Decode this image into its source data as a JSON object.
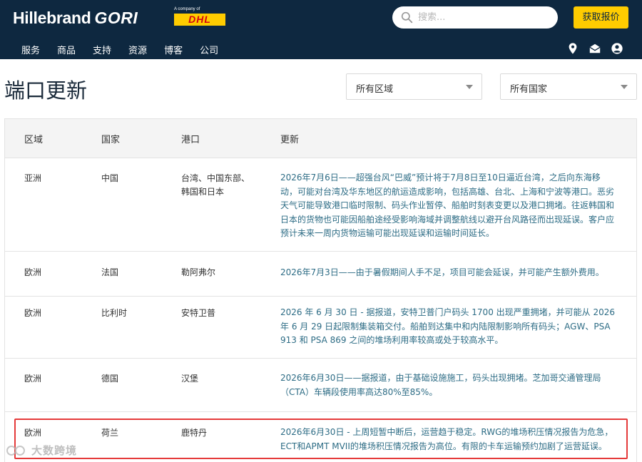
{
  "brand": {
    "name": "Hillebrand",
    "name2": "GORI",
    "company_of": "A company of",
    "parent_logo": "DHL"
  },
  "search": {
    "placeholder": "搜索..."
  },
  "header": {
    "quote_button": "获取报价"
  },
  "nav": {
    "items": [
      "服务",
      "商品",
      "支持",
      "资源",
      "博客",
      "公司"
    ]
  },
  "header_icons": [
    "location-pin-icon",
    "mail-icon",
    "user-icon"
  ],
  "page": {
    "title": "端口更新"
  },
  "filters": {
    "region": "所有区域",
    "country": "所有国家"
  },
  "table": {
    "columns": [
      "区域",
      "国家",
      "港口",
      "更新"
    ],
    "rows": [
      {
        "region": "亚洲",
        "country": "中国",
        "port": "台湾、中国东部、韩国和日本",
        "update": "2026年7月6日——超强台风“巴威”预计将于7月8日至10日逼近台湾，之后向东海移动，可能对台湾及华东地区的航运造成影响，包括高雄、台北、上海和宁波等港口。恶劣天气可能导致港口临时限制、码头作业暂停、船舶时刻表变更以及港口拥堵。往返韩国和日本的货物也可能因船舶途经受影响海域并调整航线以避开台风路径而出现延误。客户应预计未来一周内货物运输可能出现延误和运输时间延长。"
      },
      {
        "region": "欧洲",
        "country": "法国",
        "port": "勒阿弗尔",
        "update": "2026年7月3日——由于暑假期间人手不足，项目可能会延误，并可能产生额外费用。"
      },
      {
        "region": "欧洲",
        "country": "比利时",
        "port": "安特卫普",
        "update": "2026 年 6 月 30 日 - 据报道，安特卫普门户码头 1700 出现严重拥堵，并可能从 2026 年 6 月 29 日起限制集装箱交付。船舶到达集中和内陆限制影响所有码头；AGW、PSA 913 和 PSA 869 之间的堆场利用率较高或处于较高水平。"
      },
      {
        "region": "欧洲",
        "country": "德国",
        "port": "汉堡",
        "update": "2026年6月30日——据报道，由于基础设施施工，码头出现拥堵。芝加哥交通管理局（CTA）车辆段使用率高达80%至85%。"
      },
      {
        "region": "欧洲",
        "country": "荷兰",
        "port": "鹿特丹",
        "update": "2026年6月30日 - 上周短暂中断后，运营趋于稳定。RWG的堆场积压情况报告为危急，ECT和APMT MVII的堆场积压情况报告为高位。有限的卡车运输预约加剧了运营延误。"
      }
    ]
  },
  "watermark": {
    "text": "大数跨境"
  },
  "colors": {
    "header_bg": "#0e2840",
    "accent_yellow": "#ffcc00",
    "update_text": "#2d6c85",
    "highlight_border": "#e53a3a"
  }
}
